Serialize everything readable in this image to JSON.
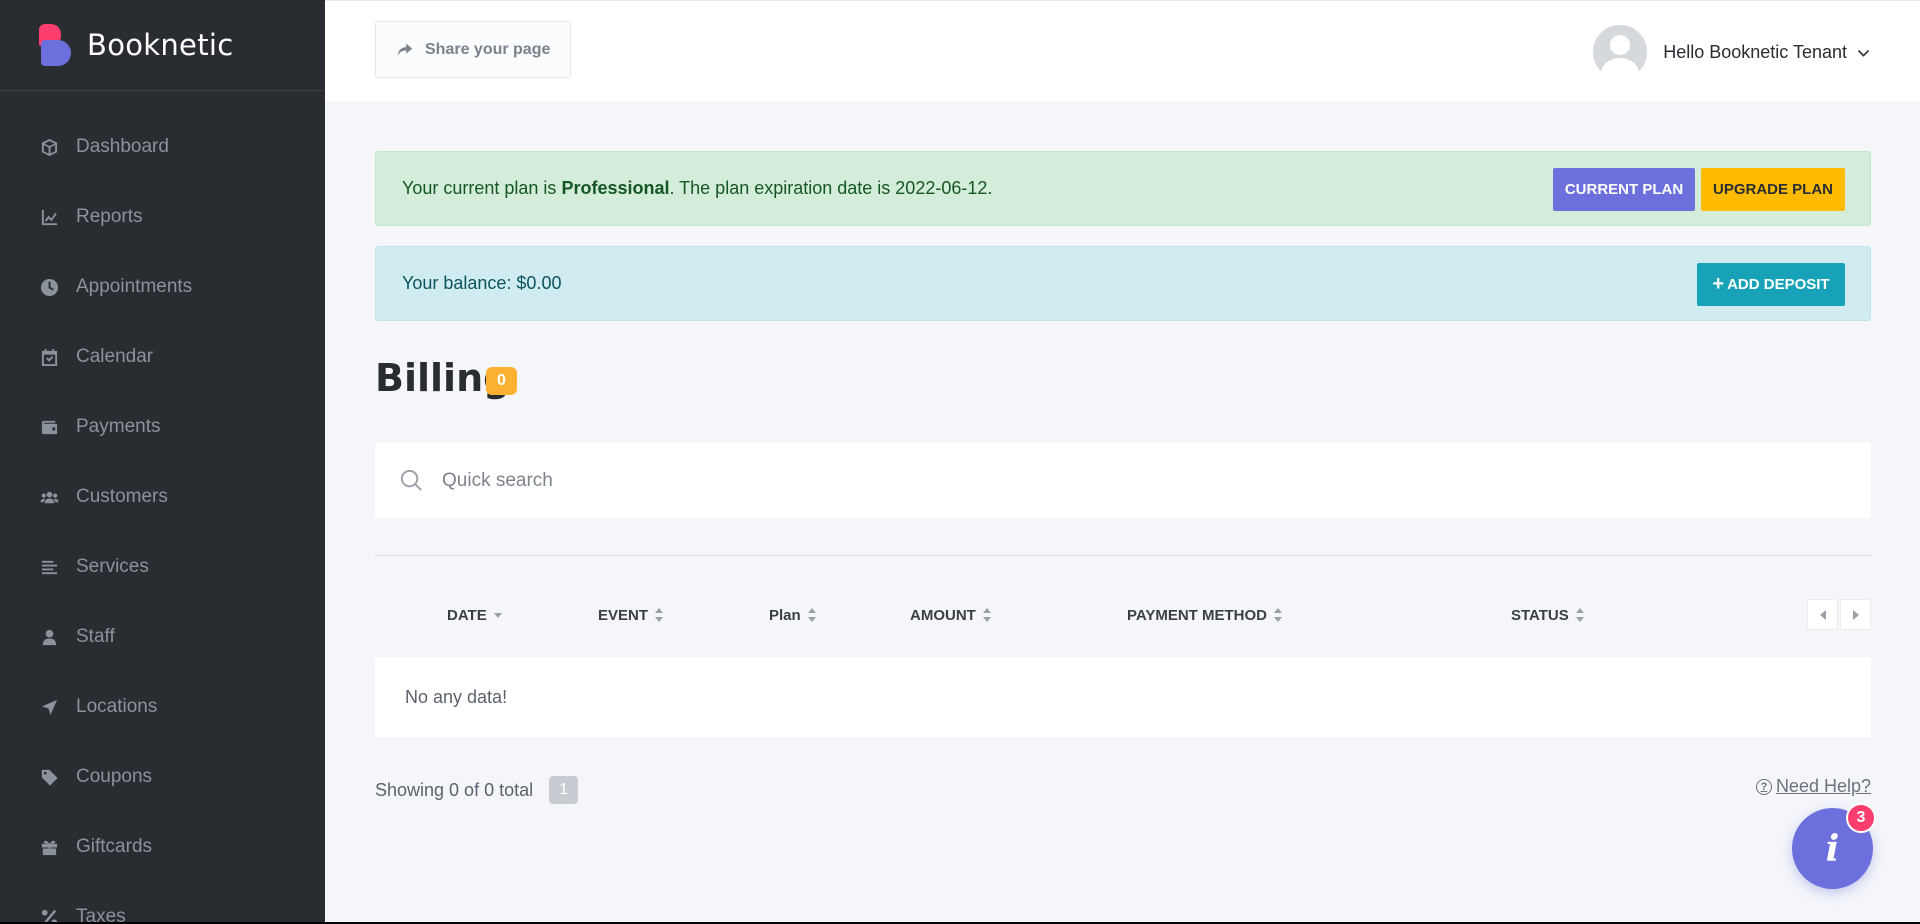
{
  "sidebar": {
    "brand": "Booknetic",
    "items": [
      {
        "label": "Dashboard",
        "icon": "cube-icon"
      },
      {
        "label": "Reports",
        "icon": "chart-line-icon"
      },
      {
        "label": "Appointments",
        "icon": "clock-icon"
      },
      {
        "label": "Calendar",
        "icon": "calendar-check-icon"
      },
      {
        "label": "Payments",
        "icon": "wallet-icon"
      },
      {
        "label": "Customers",
        "icon": "users-icon"
      },
      {
        "label": "Services",
        "icon": "list-icon"
      },
      {
        "label": "Staff",
        "icon": "user-icon"
      },
      {
        "label": "Locations",
        "icon": "location-arrow-icon"
      },
      {
        "label": "Coupons",
        "icon": "tag-icon"
      },
      {
        "label": "Giftcards",
        "icon": "gift-icon"
      },
      {
        "label": "Taxes",
        "icon": "percent-icon"
      }
    ]
  },
  "topbar": {
    "share_label": "Share your page",
    "user_greeting": "Hello Booknetic Tenant"
  },
  "plan_alert": {
    "prefix": "Your current plan is ",
    "plan_name": "Professional",
    "suffix": ". The plan expiration date is 2022-06-12.",
    "current_plan_button": "CURRENT PLAN",
    "upgrade_plan_button": "UPGRADE PLAN"
  },
  "balance_alert": {
    "text": "Your balance: $0.00",
    "add_deposit_button": "ADD DEPOSIT"
  },
  "billing": {
    "title": "Billing",
    "count": "0",
    "search_placeholder": "Quick search",
    "columns": [
      "DATE",
      "EVENT",
      "Plan",
      "AMOUNT",
      "PAYMENT METHOD",
      "STATUS"
    ],
    "empty_text": "No any data!",
    "showing_text": "Showing 0 of 0 total",
    "current_page": "1",
    "help_text": "Need Help?"
  },
  "fab": {
    "badge": "3"
  },
  "colors": {
    "sidebar_bg": "#292d32",
    "accent": "#6c70dc",
    "upgrade": "#ffbb00",
    "deposit": "#17a2b8",
    "badge": "#fb3e6e"
  }
}
